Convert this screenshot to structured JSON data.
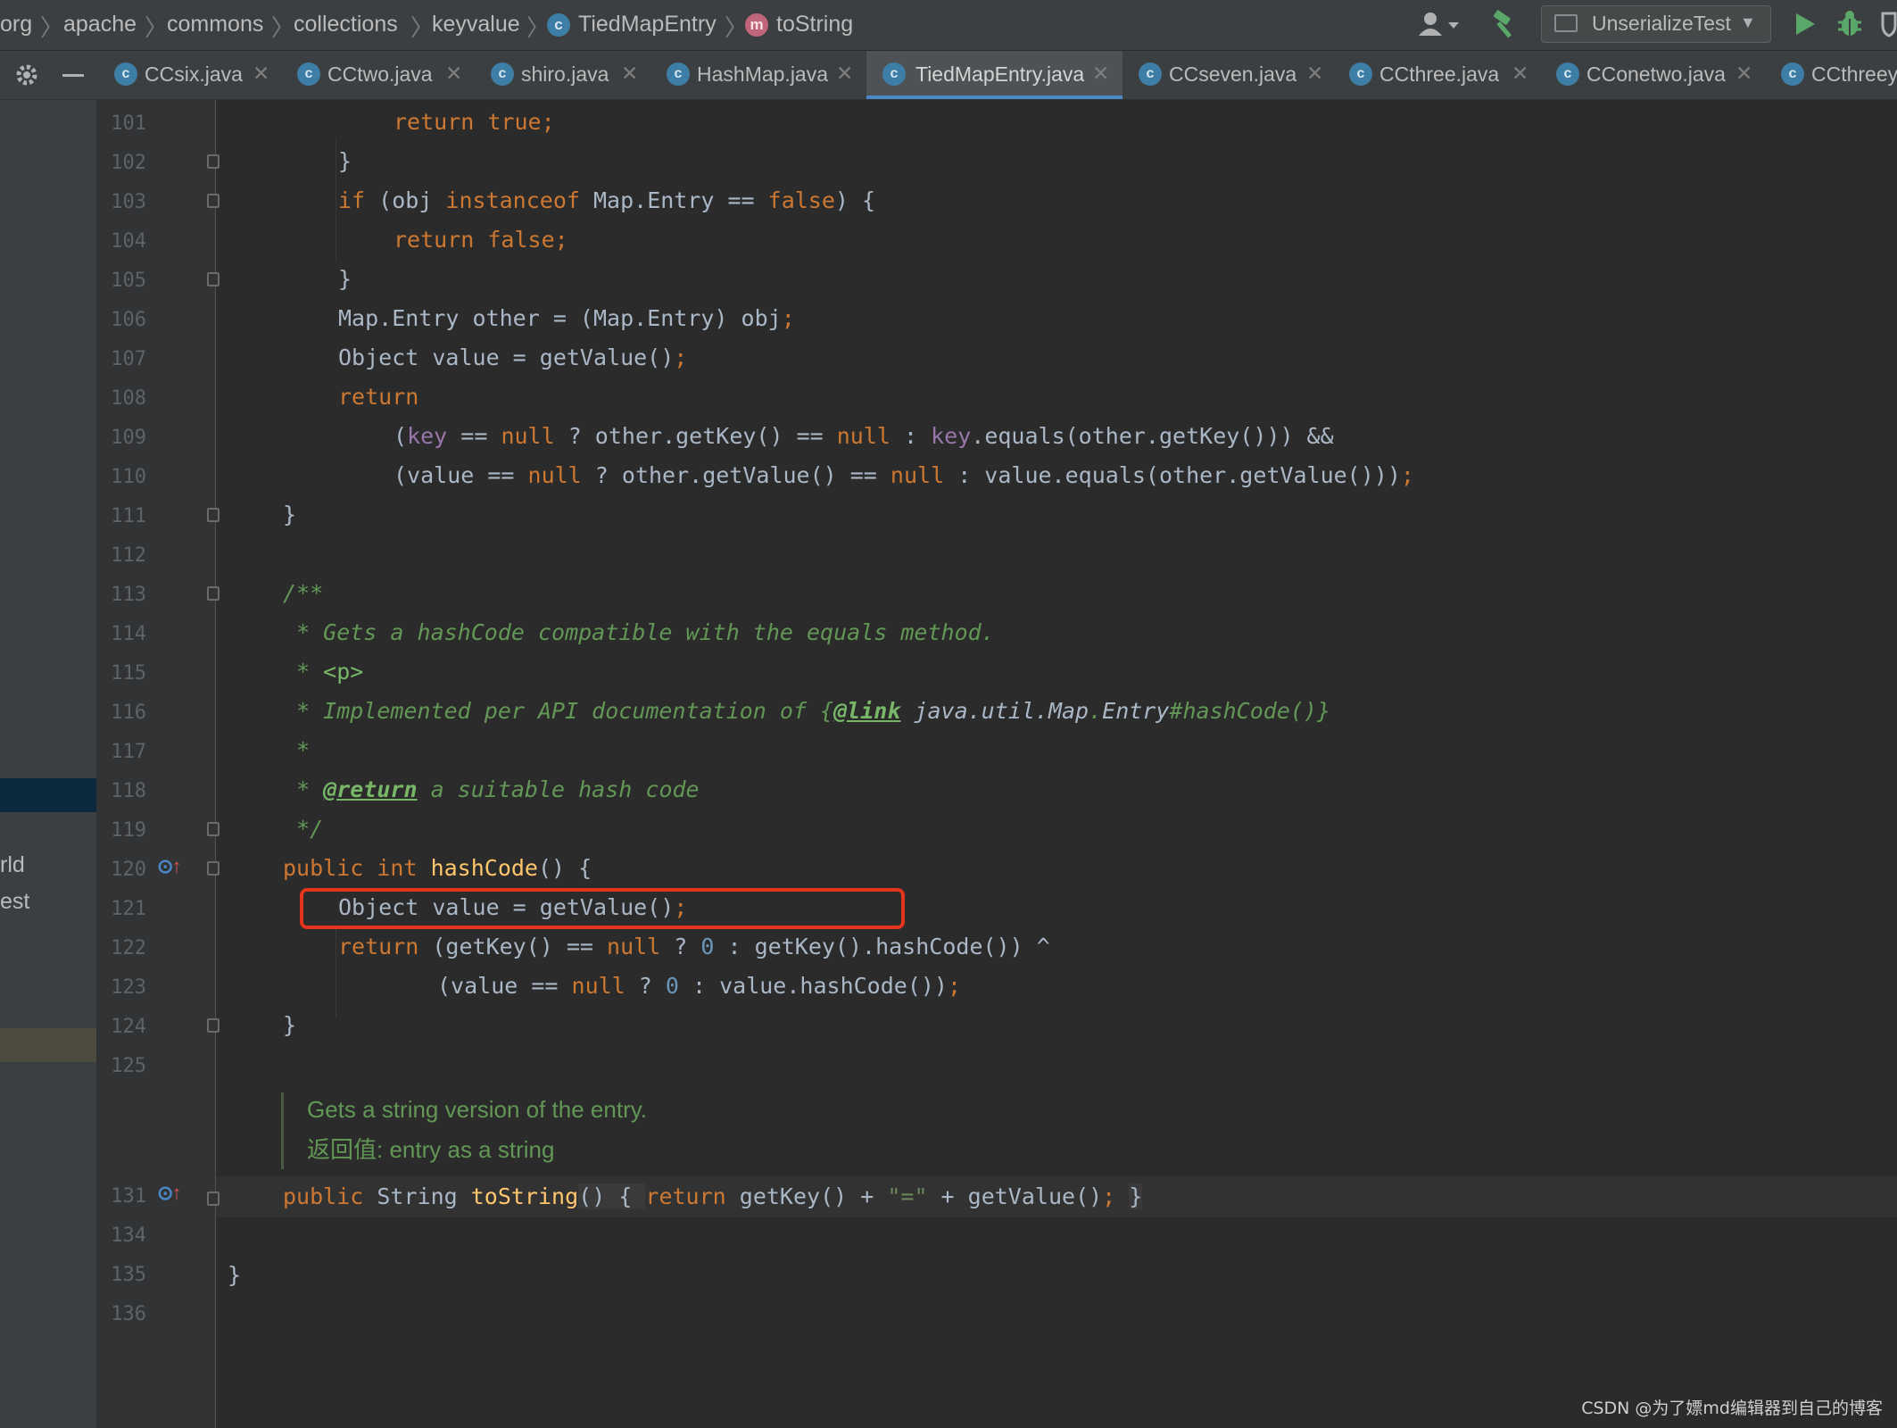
{
  "breadcrumb": {
    "items": [
      "org",
      "apache",
      "commons",
      "collections",
      "keyvalue"
    ],
    "class_name": "TiedMapEntry",
    "method_name": "toString",
    "class_icon_letter": "c",
    "method_icon_letter": "m"
  },
  "toolbar": {
    "run_config": "UnserializeTest"
  },
  "tabs": [
    {
      "label": "CCsix.java",
      "active": false
    },
    {
      "label": "CCtwo.java",
      "active": false
    },
    {
      "label": "shiro.java",
      "active": false
    },
    {
      "label": "HashMap.java",
      "active": false
    },
    {
      "label": "TiedMapEntry.java",
      "active": true
    },
    {
      "label": "CCseven.java",
      "active": false
    },
    {
      "label": "CCthree.java",
      "active": false
    },
    {
      "label": "CConetwo.java",
      "active": false
    },
    {
      "label": "CCthreey",
      "active": false
    }
  ],
  "side_panel": {
    "line1": "rld",
    "line2": "est"
  },
  "line_numbers": [
    "101",
    "102",
    "103",
    "104",
    "105",
    "106",
    "107",
    "108",
    "109",
    "110",
    "111",
    "112",
    "113",
    "114",
    "115",
    "116",
    "117",
    "118",
    "119",
    "120",
    "121",
    "122",
    "123",
    "124",
    "125",
    "131",
    "134",
    "135",
    "136"
  ],
  "code": {
    "l101": "return true;",
    "l102": "}",
    "l103_a": "if",
    "l103_b": " (obj ",
    "l103_c": "instanceof",
    "l103_d": " Map.Entry == ",
    "l103_e": "false",
    "l103_f": ") {",
    "l104_a": "return false",
    "l104_b": ";",
    "l105": "}",
    "l106_a": "Map.Entry other = (Map.Entry) obj",
    "l106_b": ";",
    "l107_a": "Object value = getValue()",
    "l107_b": ";",
    "l108": "return",
    "l109_a": "(",
    "l109_b": "key",
    "l109_c": " == ",
    "l109_d": "null",
    "l109_e": " ? other.getKey() == ",
    "l109_f": "null",
    "l109_g": " : ",
    "l109_h": "key",
    "l109_i": ".equals(other.getKey())) &&",
    "l110_a": "(value == ",
    "l110_b": "null",
    "l110_c": " ? other.getValue() == ",
    "l110_d": "null",
    "l110_e": " : value.equals(other.getValue()))",
    "l110_f": ";",
    "l111": "}",
    "l113": "/**",
    "l114": " * Gets a hashCode compatible with the equals method.",
    "l115_a": " * ",
    "l115_b": "<p>",
    "l116_a": " * Implemented per API documentation of {",
    "l116_b": "@link",
    "l116_c": " java.util.Map",
    "l116_d": ".",
    "l116_e": "Entry",
    "l116_f": "#hashCode()}",
    "l117": " *",
    "l118_a": " * ",
    "l118_b": "@return",
    "l118_c": " a suitable hash code",
    "l119": " */",
    "l120_a": "public int ",
    "l120_b": "hashCode",
    "l120_c": "() {",
    "l121_a": "Object value = getValue()",
    "l121_b": ";",
    "l122_a": "return",
    "l122_b": " (getKey() == ",
    "l122_c": "null",
    "l122_d": " ? ",
    "l122_e": "0",
    "l122_f": " : getKey().hashCode()) ^",
    "l123_a": "(value == ",
    "l123_b": "null",
    "l123_c": " ? ",
    "l123_d": "0",
    "l123_e": " : value.hashCode())",
    "l123_f": ";",
    "l124": "}",
    "l131_a": "public ",
    "l131_b": "String ",
    "l131_c": "toString",
    "l131_d": "() { ",
    "l131_e": "return",
    "l131_f": " getKey() + ",
    "l131_g": "\"=\"",
    "l131_h": " + getValue()",
    "l131_i": "; ",
    "l131_j": "}",
    "l135": "}"
  },
  "rendered_doc": {
    "summary": "Gets a string version of the entry.",
    "returns_label": "返回值:",
    "returns_text": " entry as a string"
  },
  "watermark": "CSDN @为了嫖md编辑器到自己的博客",
  "colors": {
    "keyword": "#cc7832",
    "method": "#ffc66d",
    "number": "#6897bb",
    "string": "#6a8759",
    "field": "#9876aa",
    "doc_comment": "#629755",
    "highlight_box": "#e5341c",
    "active_tab_underline": "#4a88c7"
  }
}
